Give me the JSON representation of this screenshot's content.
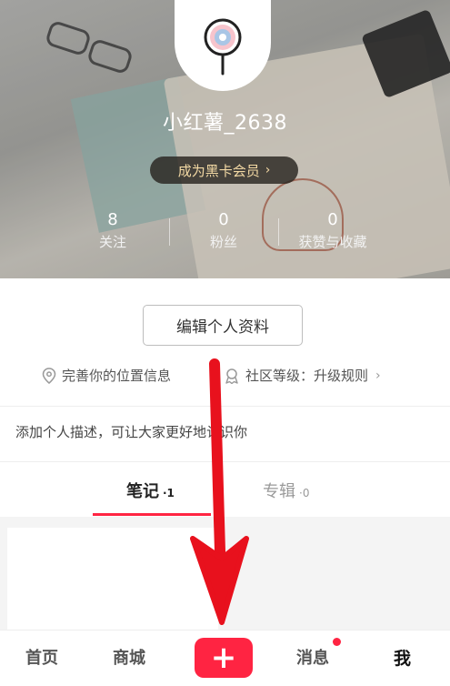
{
  "profile": {
    "username": "小红薯_2638",
    "vip_label": "成为黑卡会员",
    "vip_chevron": "›",
    "stats": [
      {
        "value": "8",
        "label": "关注"
      },
      {
        "value": "0",
        "label": "粉丝"
      },
      {
        "value": "0",
        "label": "获赞与收藏"
      }
    ],
    "edit_label": "编辑个人资料",
    "location_label": "完善你的位置信息",
    "level_label": "社区等级：升级规则",
    "level_chevron": "›",
    "description": "添加个人描述，可让大家更好地认识你"
  },
  "tabs": {
    "notes_label": "笔记",
    "notes_count": "·1",
    "album_label": "专辑",
    "album_count": "·0"
  },
  "nav": {
    "home": "首页",
    "mall": "商城",
    "plus": "+",
    "messages": "消息",
    "me": "我"
  },
  "colors": {
    "accent": "#ff2442",
    "vip_text": "#f3d9a4",
    "arrow": "#e8111d"
  },
  "icons": {
    "avatar": "lollipop-avatar-icon",
    "location": "location-pin-icon",
    "level": "community-level-icon",
    "arrow": "down-arrow-annotation"
  }
}
